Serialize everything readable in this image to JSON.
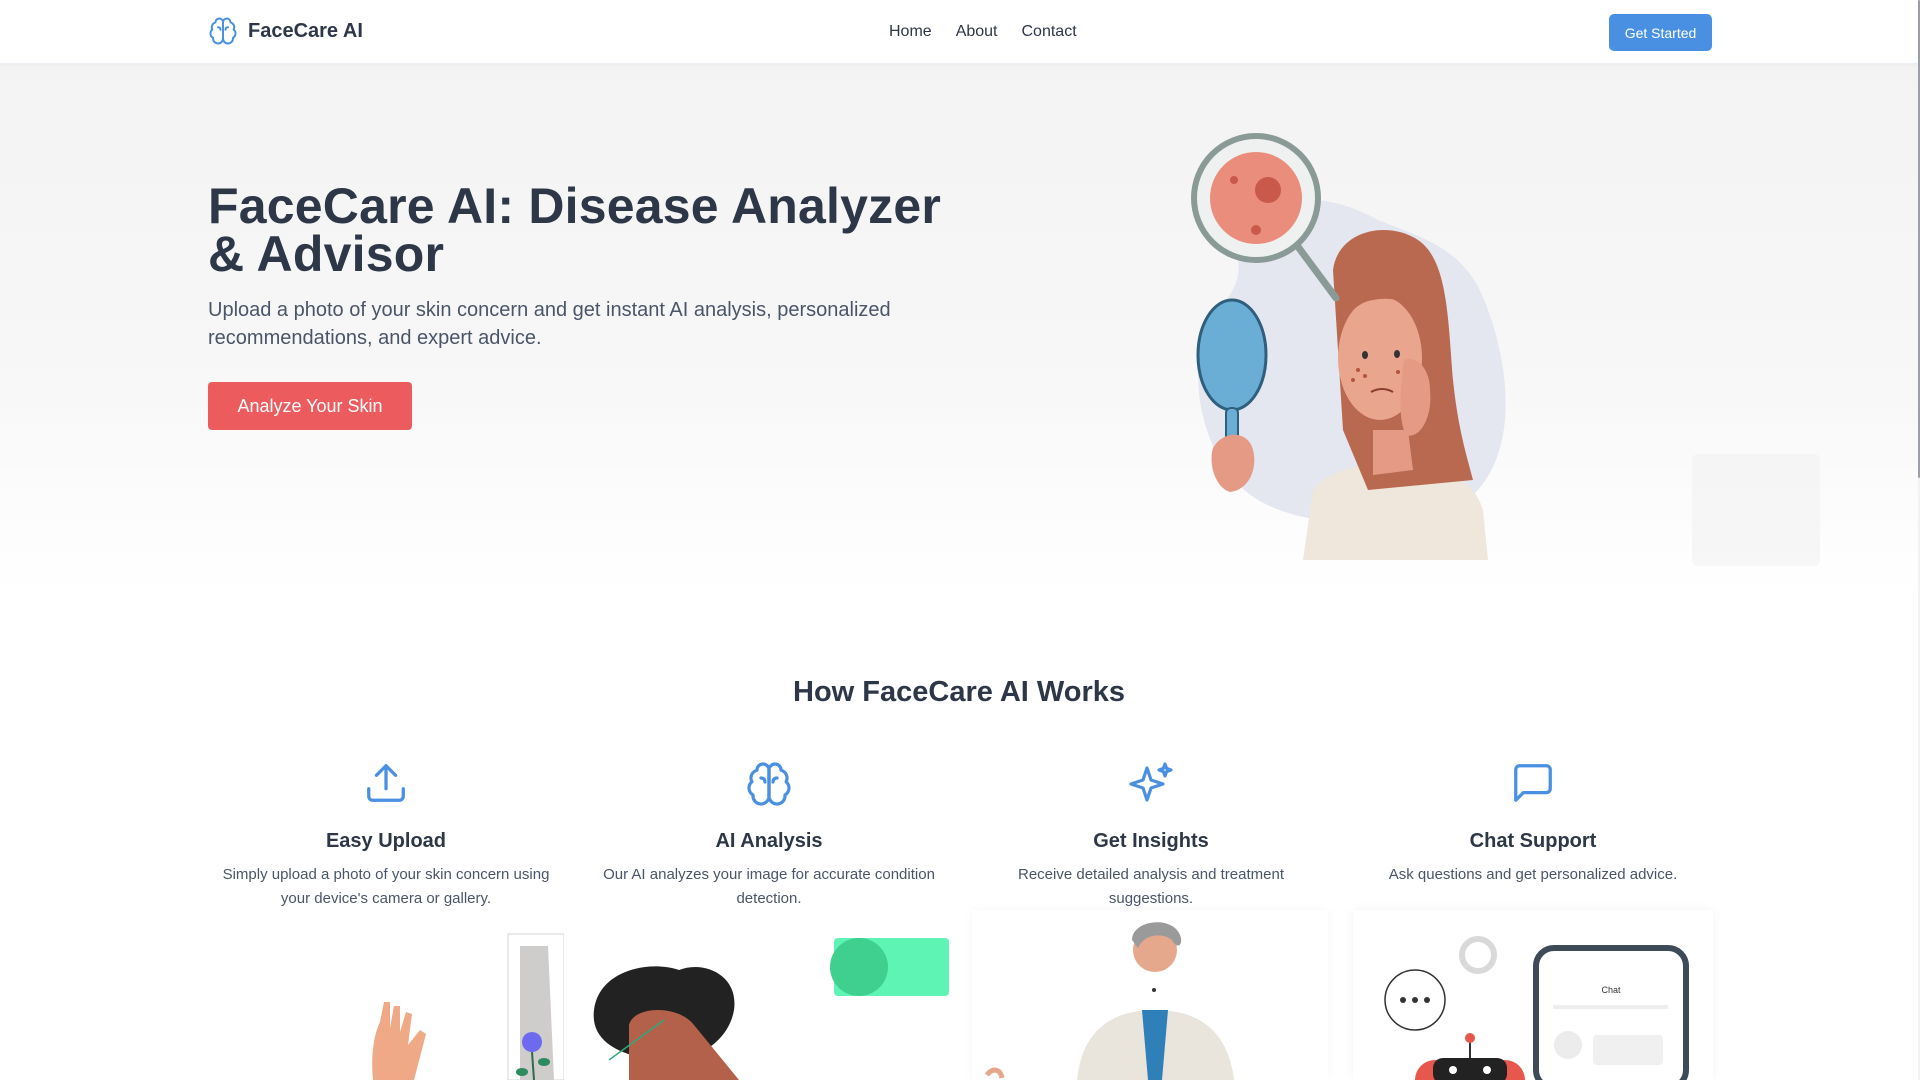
{
  "header": {
    "brand": "FaceCare AI",
    "nav": [
      "Home",
      "About",
      "Contact"
    ],
    "cta": "Get Started"
  },
  "hero": {
    "title": "FaceCare AI: Disease Analyzer & Advisor",
    "subtitle": "Upload a photo of your skin concern and get instant AI analysis, personalized recommendations, and expert advice.",
    "button": "Analyze Your Skin"
  },
  "how": {
    "title": "How FaceCare AI Works",
    "features": [
      {
        "title": "Easy Upload",
        "text": "Simply upload a photo of your skin concern using your device's camera or gallery.",
        "icon": "upload-icon"
      },
      {
        "title": "AI Analysis",
        "text": "Our AI analyzes your image for accurate condition detection.",
        "icon": "brain-icon"
      },
      {
        "title": "Get Insights",
        "text": "Receive detailed analysis and treatment suggestions.",
        "icon": "sparkles-icon"
      },
      {
        "title": "Chat Support",
        "text": "Ask questions and get personalized advice.",
        "icon": "chat-icon"
      }
    ],
    "chat_mock_label": "Chat"
  },
  "colors": {
    "accent": "#4a90e2",
    "hero_button": "#ec5b5d",
    "text": "#2d3748"
  }
}
